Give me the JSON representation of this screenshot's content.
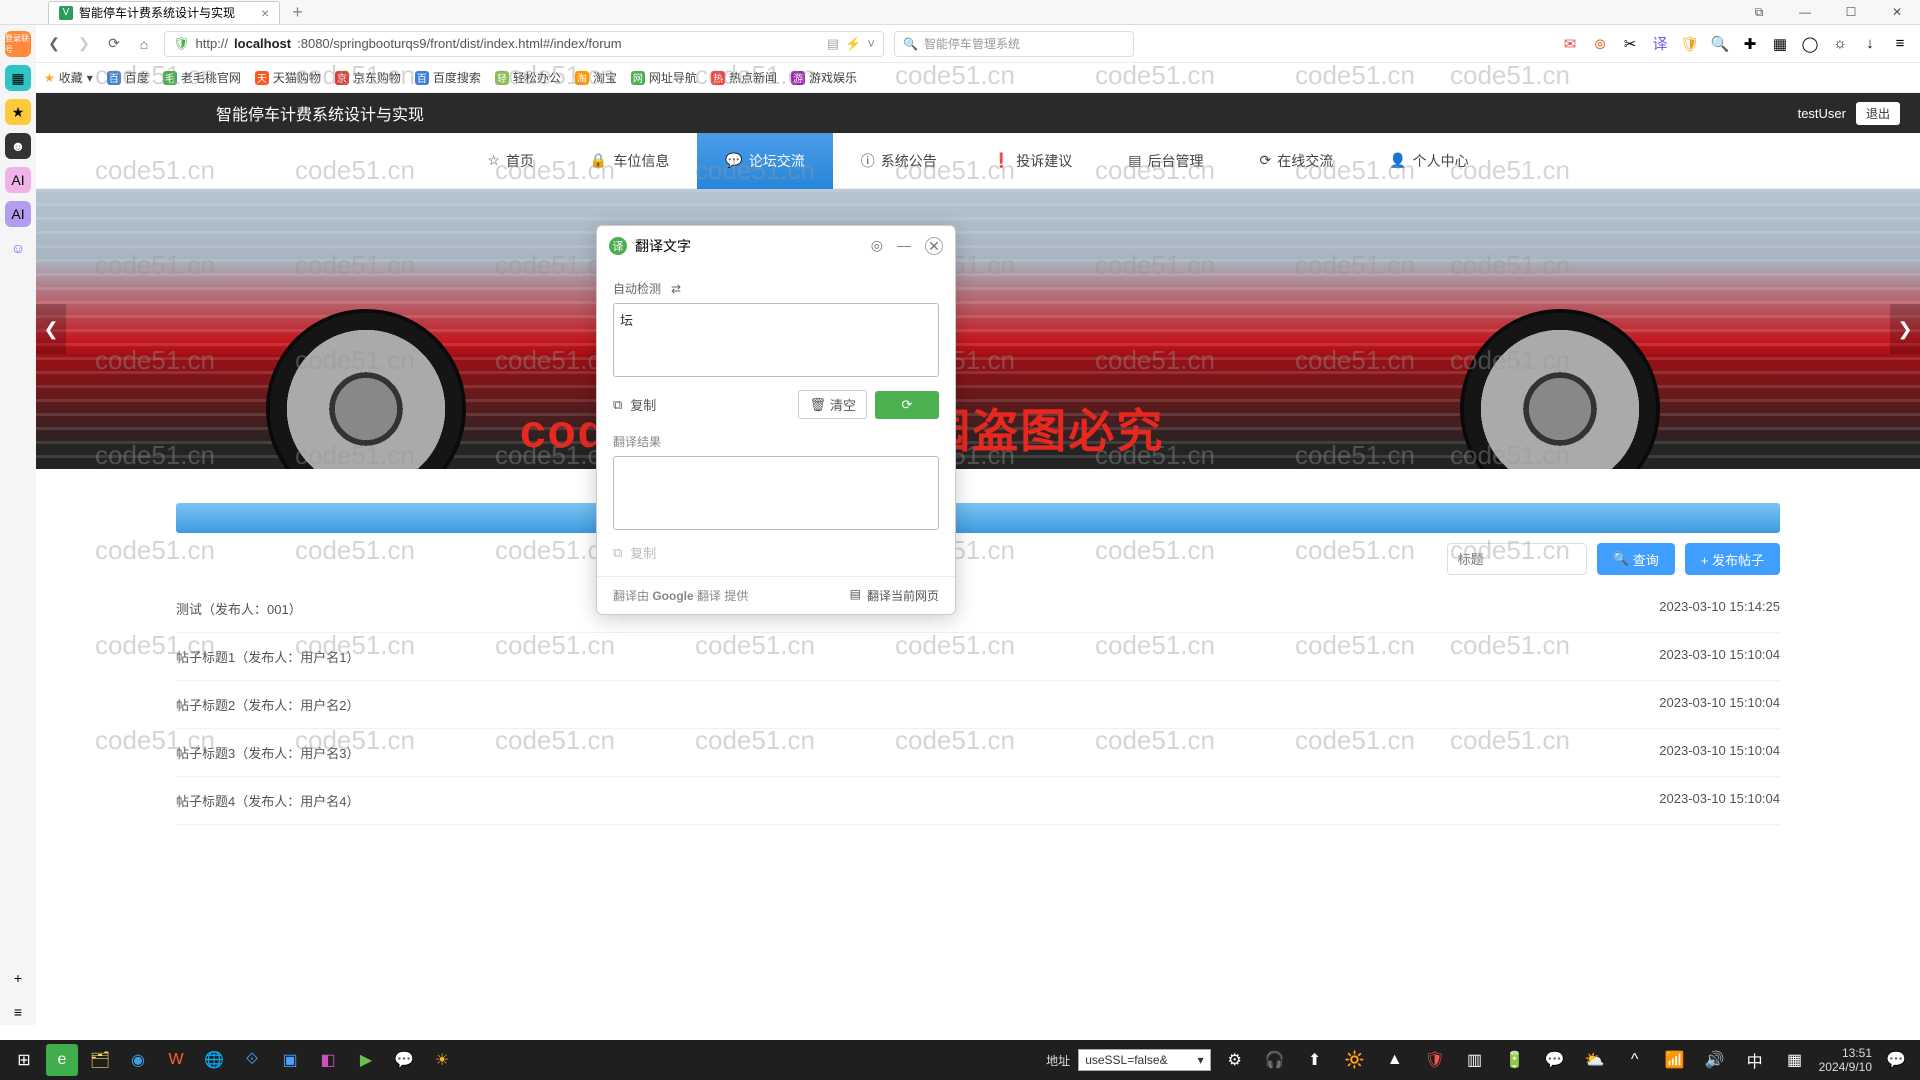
{
  "browser": {
    "tab_title": "智能停车计费系统设计与实现",
    "url_plain": "http://",
    "url_host": "localhost",
    "url_rest": ":8080/springbooturqs9/front/dist/index.html#/index/forum",
    "search_placeholder": "智能停车管理系统",
    "bookmarks_label": "收藏",
    "bookmarks": [
      "百度",
      "老毛桃官网",
      "天猫购物",
      "京东购物",
      "百度搜索",
      "轻松办公",
      "淘宝",
      "网址导航",
      "热点新闻",
      "游戏娱乐"
    ],
    "left_badge": "登录联号",
    "win": {
      "pip": "⧉",
      "min": "—",
      "max": "☐",
      "close": "✕"
    }
  },
  "app": {
    "title": "智能停车计费系统设计与实现",
    "user": "testUser",
    "logout": "退出",
    "nav": [
      "首页",
      "车位信息",
      "论坛交流",
      "系统公告",
      "投诉建议",
      "后台管理",
      "在线交流",
      "个人中心"
    ]
  },
  "forum": {
    "search_placeholder": "标题",
    "query_btn": "查询",
    "post_btn": "+ 发布帖子",
    "posts": [
      {
        "t": "测试（发布人：001）",
        "d": "2023-03-10 15:14:25"
      },
      {
        "t": "帖子标题1（发布人：用户名1）",
        "d": "2023-03-10 15:10:04"
      },
      {
        "t": "帖子标题2（发布人：用户名2）",
        "d": "2023-03-10 15:10:04"
      },
      {
        "t": "帖子标题3（发布人：用户名3）",
        "d": "2023-03-10 15:10:04"
      },
      {
        "t": "帖子标题4（发布人：用户名4）",
        "d": "2023-03-10 15:10:04"
      }
    ]
  },
  "translate": {
    "title": "翻译文字",
    "lang": "自动检测",
    "input": "坛",
    "copy": "复制",
    "clear": "清空",
    "result_label": "翻译结果",
    "powered_prefix": "翻译由 ",
    "powered_brand": "Google",
    "powered_suffix": " 翻译 提供",
    "translate_page": "翻译当前网页"
  },
  "watermark_text": "code51.cn",
  "red_watermark": "code51.cn-源码乐园盗图必究",
  "taskbar": {
    "addr_label": "地址",
    "dropdown": "useSSL=false&",
    "time": "13:51",
    "date": "2024/9/10"
  }
}
